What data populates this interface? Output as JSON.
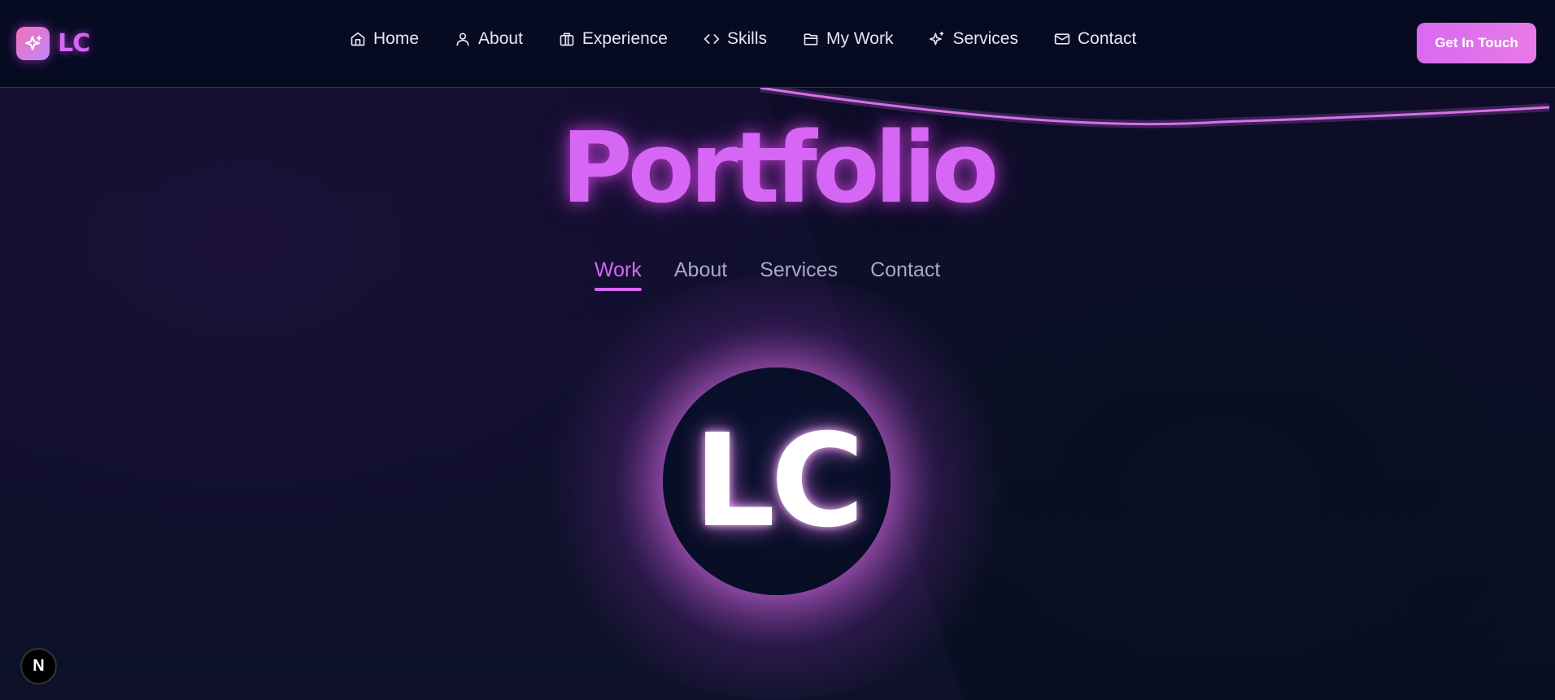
{
  "brand": {
    "logo_text": "LC",
    "logo_icon": "sparkles-icon"
  },
  "nav": {
    "items": [
      {
        "label": "Home",
        "icon": "home-icon"
      },
      {
        "label": "About",
        "icon": "user-icon"
      },
      {
        "label": "Experience",
        "icon": "briefcase-icon"
      },
      {
        "label": "Skills",
        "icon": "code-icon"
      },
      {
        "label": "My Work",
        "icon": "folder-icon"
      },
      {
        "label": "Services",
        "icon": "sparkles-icon"
      },
      {
        "label": "Contact",
        "icon": "mail-icon"
      }
    ],
    "cta_label": "Get In Touch"
  },
  "hero": {
    "title": "Portfolio",
    "tabs": [
      {
        "label": "Work",
        "active": true
      },
      {
        "label": "About",
        "active": false
      },
      {
        "label": "Services",
        "active": false
      },
      {
        "label": "Contact",
        "active": false
      }
    ],
    "avatar_text": "LC"
  },
  "dev_badge": {
    "label": "N"
  },
  "colors": {
    "accent": "#d667f5",
    "nav_bg": "#060b22",
    "page_bg": "#0d1029",
    "cta_start": "#d86af0",
    "cta_end": "#e87ae8"
  }
}
